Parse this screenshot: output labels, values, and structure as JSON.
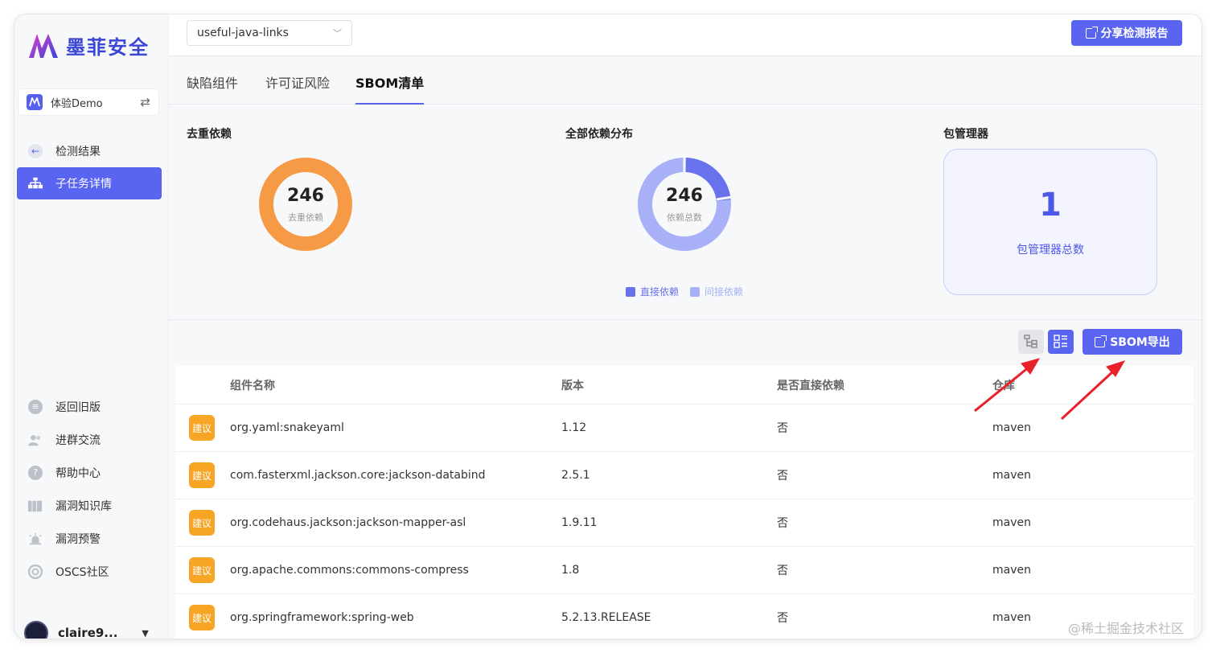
{
  "app": {
    "brand": "墨菲安全"
  },
  "team": {
    "label": "体验Demo"
  },
  "sidebar": {
    "top_items": [
      {
        "label": "检测结果",
        "icon": "arrow-left-icon"
      },
      {
        "label": "子任务详情",
        "icon": "sitemap-icon"
      }
    ],
    "bottom_items": [
      {
        "label": "返回旧版",
        "icon": "return-icon"
      },
      {
        "label": "进群交流",
        "icon": "users-icon"
      },
      {
        "label": "帮助中心",
        "icon": "help-icon"
      },
      {
        "label": "漏洞知识库",
        "icon": "books-icon"
      },
      {
        "label": "漏洞预警",
        "icon": "alarm-icon"
      },
      {
        "label": "OSCS社区",
        "icon": "community-icon"
      }
    ],
    "user": {
      "name": "claire9..."
    }
  },
  "topbar": {
    "project": "useful-java-links",
    "share_label": "分享检测报告"
  },
  "tabs": [
    {
      "label": "缺陷组件",
      "active": false
    },
    {
      "label": "许可证风险",
      "active": false
    },
    {
      "label": "SBOM清单",
      "active": true
    }
  ],
  "stats": {
    "dedup": {
      "title": "去重依赖",
      "value": "246",
      "label": "去重依赖"
    },
    "all": {
      "title": "全部依赖分布",
      "value": "246",
      "label": "依赖总数",
      "legend": [
        {
          "label": "直接依赖",
          "color": "#6872ec"
        },
        {
          "label": "间接依赖",
          "color": "#a8b0f7"
        }
      ]
    },
    "pm": {
      "title": "包管理器",
      "value": "1",
      "label": "包管理器总数"
    }
  },
  "toolbar": {
    "export_label": "SBOM导出"
  },
  "table": {
    "headers": [
      "组件名称",
      "版本",
      "是否直接依赖",
      "仓库"
    ],
    "rows": [
      {
        "badge": "建议",
        "name": "org.yaml:snakeyaml",
        "version": "1.12",
        "direct": "否",
        "repo": "maven"
      },
      {
        "badge": "建议",
        "name": "com.fasterxml.jackson.core:jackson-databind",
        "version": "2.5.1",
        "direct": "否",
        "repo": "maven"
      },
      {
        "badge": "建议",
        "name": "org.codehaus.jackson:jackson-mapper-asl",
        "version": "1.9.11",
        "direct": "否",
        "repo": "maven"
      },
      {
        "badge": "建议",
        "name": "org.apache.commons:commons-compress",
        "version": "1.8",
        "direct": "否",
        "repo": "maven"
      },
      {
        "badge": "建议",
        "name": "org.springframework:spring-web",
        "version": "5.2.13.RELEASE",
        "direct": "否",
        "repo": "maven"
      }
    ]
  },
  "watermark": "@稀土掘金技术社区",
  "colors": {
    "accent": "#5965f0",
    "badge": "#f7a524",
    "donut_orange": "#f79a45",
    "arrow": "#e8202a"
  }
}
